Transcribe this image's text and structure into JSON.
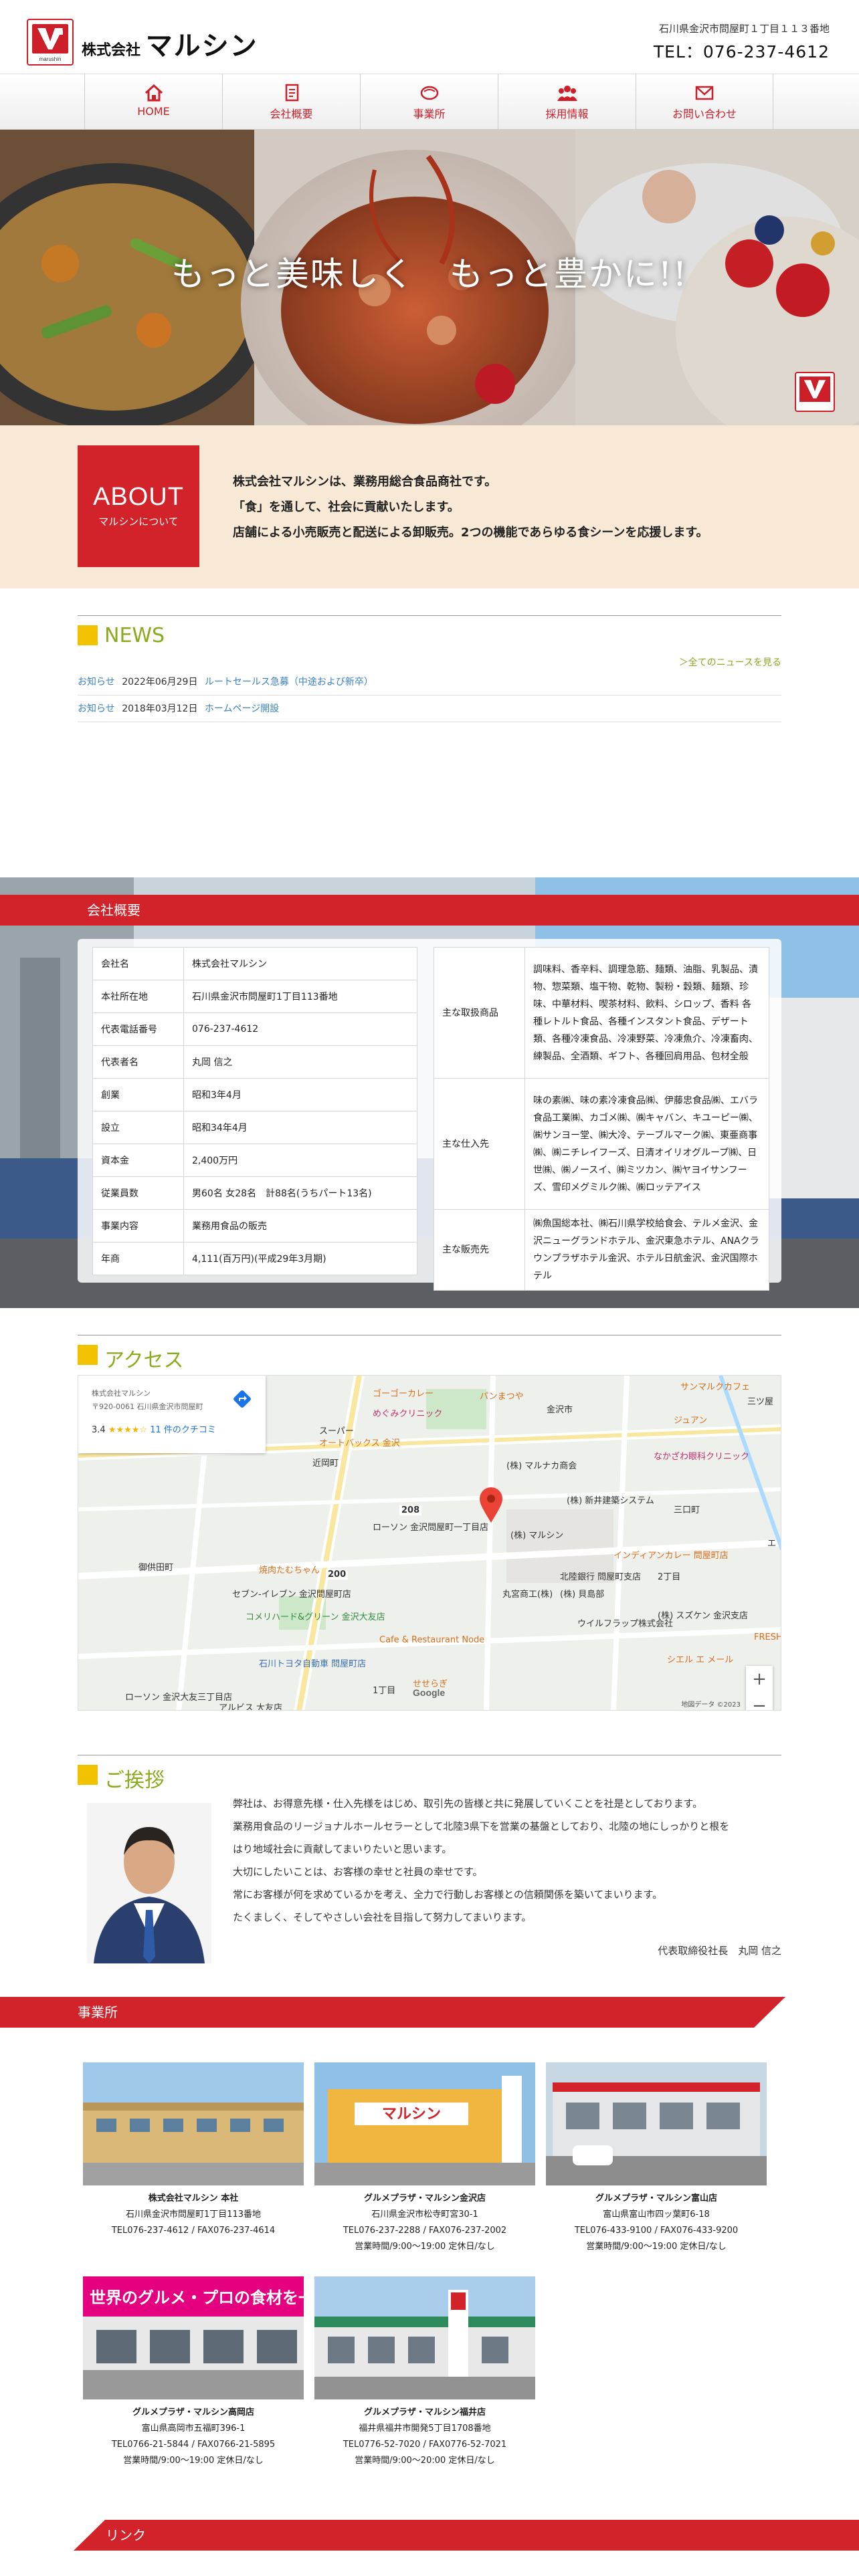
{
  "header": {
    "logo_small": "marushin",
    "company_prefix": "株式会社",
    "company_name": "マルシン",
    "address": "石川県金沢市問屋町１丁目１１３番地",
    "tel": "TEL：076-237-4612"
  },
  "nav": [
    {
      "label": "HOME",
      "icon": "home-icon"
    },
    {
      "label": "会社概要",
      "icon": "document-icon"
    },
    {
      "label": "事業所",
      "icon": "store-icon"
    },
    {
      "label": "採用情報",
      "icon": "people-icon"
    },
    {
      "label": "お問い合わせ",
      "icon": "mail-icon"
    }
  ],
  "hero": {
    "catch": "もっと美味しく　もっと豊かに!!"
  },
  "about": {
    "en": "ABOUT",
    "jp": "マルシンについて",
    "lines": [
      "株式会社マルシンは、業務用総合食品商社です。",
      "「食」を通して、社会に貢献いたします。",
      "店舗による小売販売と配送による卸販売。2つの機能であらゆる食シーンを応援します。"
    ]
  },
  "news": {
    "title": "NEWS",
    "all_link": "＞全てのニュースを見る",
    "items": [
      {
        "category": "お知らせ",
        "date": "2022年06月29日",
        "title": "ルートセールス急募（中途および新卒）"
      },
      {
        "category": "お知らせ",
        "date": "2018年03月12日",
        "title": "ホームページ開設"
      }
    ]
  },
  "overview": {
    "title": "会社概要",
    "left": [
      {
        "k": "会社名",
        "v": "株式会社マルシン"
      },
      {
        "k": "本社所在地",
        "v": "石川県金沢市問屋町1丁目113番地"
      },
      {
        "k": "代表電話番号",
        "v": "076-237-4612"
      },
      {
        "k": "代表者名",
        "v": "丸岡 信之"
      },
      {
        "k": "創業",
        "v": "昭和3年4月"
      },
      {
        "k": "設立",
        "v": "昭和34年4月"
      },
      {
        "k": "資本金",
        "v": "2,400万円"
      },
      {
        "k": "従業員数",
        "v": "男60名 女28名　計88名(うちパート13名)"
      },
      {
        "k": "事業内容",
        "v": "業務用食品の販売"
      },
      {
        "k": "年商",
        "v": "4,111(百万円)(平成29年3月期)"
      }
    ],
    "right": [
      {
        "k": "主な取扱商品",
        "v": "調味料、香辛料、調理急筋、麺類、油脂、乳製品、漬物、惣菜類、塩干物、乾物、製粉・穀類、麺類、珍味、中華材料、喫茶材料、飲料、シロップ、香料 各種レトルト食品、各種インスタント食品、デザート類、各種冷凍食品、冷凍野菜、冷凍魚介、冷凍畜肉、練製品、全酒類、ギフト、各種回肩用品、包材全般"
      },
      {
        "k": "主な仕入先",
        "v": "味の素㈱、味の素冷凍食品㈱、伊藤忠食品㈱、エバラ食品工業㈱、カゴメ㈱、㈱キャバン、キユーピー㈱、㈱サンヨー堂、㈱大冷、テーブルマーク㈱、東亜商事㈱、㈱ニチレイフーズ、日清オイリオグループ㈱、日世㈱、㈱ノースイ、㈱ミツカン、㈱ヤヨイサンフーズ、雪印メグミルク㈱、㈱ロッテアイス"
      },
      {
        "k": "主な販売先",
        "v": "㈱魚国総本社、㈱石川県学校給食会、テルメ金沢、金沢ニューグランドホテル、金沢東急ホテル、ANAクラウンプラザホテル金沢、ホテル日航金沢、金沢国際ホテル"
      }
    ]
  },
  "access": {
    "title": "アクセス",
    "card_title": "株式会社マルシン",
    "card_address": "〒920-0061 石川県金沢市問屋町",
    "rating": "3.4",
    "stars": "★★★★☆",
    "reviews": "11 件のクチコミ",
    "labels": {
      "l1": "めぐみクリニック",
      "l2": "スーパー",
      "l3": "オートバックス 金沢",
      "l4": "近岡町",
      "l5": "(株) マルナカ商会",
      "l6": "(株) 新井建築システム",
      "l7": "(株) マルシン",
      "l8": "ローソン 金沢問屋町一丁目店",
      "l9": "インディアンカレー 問屋町店",
      "l10": "焼肉たむちゃん",
      "l11": "セブン-イレブン 金沢問屋町店",
      "l12": "丸宮商工(株)",
      "l13": "(株) 貝島部",
      "l14": "コメリハード&グリーン 金沢大友店",
      "l15": "Cafe & Restaurant Node",
      "l16": "ウイルフラップ株式会社",
      "l17": "(株) スズケン 金沢支店",
      "l18": "石川トヨタ自動車 問屋町店",
      "l19": "ジュアン",
      "l20": "なかざわ眼科クリニック",
      "l21": "三口町",
      "l22": "北陸銀行 問屋町支店",
      "l23": "御供田町",
      "l24": "せせらぎ",
      "l25": "ローソン 金沢大友三丁目店",
      "l26": "アルビス 大友店",
      "l27": "1丁目",
      "l28": "2丁目",
      "l29": "三ツ屋",
      "l30": "サンマルクカフェ",
      "l31": "エ",
      "l32": "シエル エ メール",
      "l33": "FRESH",
      "l34": "ゴーゴーカレー",
      "l35": "パンまつや",
      "l36": "金沢市"
    },
    "road_208": "208",
    "road_200": "200",
    "credit": "地図データ ©2023",
    "google": "Google",
    "zoom_in": "+",
    "zoom_out": "−"
  },
  "greeting": {
    "title": "ご挨拶",
    "lines": [
      "弊社は、お得意先様・仕入先様をはじめ、取引先の皆様と共に発展していくことを社是としております。",
      "業務用食品のリージョナルホールセラーとして北陸3県下を営業の基盤としており、北陸の地にしっかりと根を",
      "はり地域社会に貢献してまいりたいと思います。",
      "大切にしたいことは、お客様の幸せと社員の幸せです。",
      "常にお客様が何を求めているかを考え、全力で行動しお客様との信頼関係を築いてまいります。",
      "たくましく、そしてやさしい会社を目指して努力してまいります。"
    ],
    "signature": "代表取締役社長　丸岡 信之"
  },
  "offices": {
    "title": "事業所",
    "items": [
      {
        "name": "株式会社マルシン 本社",
        "address": "石川県金沢市問屋町1丁目113番地",
        "tel": "TEL076-237-4612 / FAX076-237-4614",
        "hours": ""
      },
      {
        "name": "グルメプラザ・マルシン金沢店",
        "address": "石川県金沢市松寺町宮30-1",
        "tel": "TEL076-237-2288 / FAX076-237-2002",
        "hours": "営業時間/9:00〜19:00 定休日/なし"
      },
      {
        "name": "グルメプラザ・マルシン富山店",
        "address": "富山県富山市四ッ葉町6-18",
        "tel": "TEL076-433-9100 / FAX076-433-9200",
        "hours": "営業時間/9:00〜19:00 定休日/なし"
      },
      {
        "name": "グルメプラザ・マルシン高岡店",
        "address": "富山県高岡市五福町396-1",
        "tel": "TEL0766-21-5844 / FAX0766-21-5895",
        "hours": "営業時間/9:00〜19:00 定休日/なし"
      },
      {
        "name": "グルメプラザ・マルシン福井店",
        "address": "福井県福井市開発5丁目1708番地",
        "tel": "TEL0776-52-7020 / FAX0776-52-7021",
        "hours": "営業時間/9:00〜20:00 定休日/なし"
      }
    ],
    "sign_text": "世界のグルメ・プロの食材を一堂に",
    "sign_store": "マルシン"
  },
  "links": {
    "title": "リンク"
  },
  "colors": {
    "brand_red": "#d2232a",
    "accent_green": "#8aab1e",
    "accent_yellow": "#f2c200",
    "link_blue": "#3a82c4",
    "about_bg": "#f8e9d6"
  }
}
